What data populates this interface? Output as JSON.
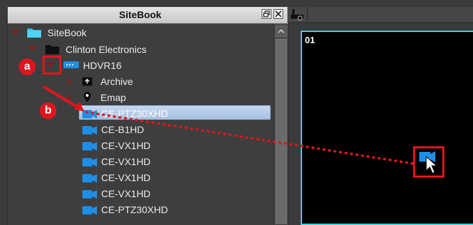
{
  "panel": {
    "title": "SiteBook"
  },
  "tree": {
    "root": "SiteBook",
    "site": "Clinton Electronics",
    "recorder": "HDVR16",
    "archive": "Archive",
    "emap": "Emap",
    "cameras": [
      "CE-PTZ30XHD",
      "CE-B1HD",
      "CE-VX1HD",
      "CE-VX1HD",
      "CE-VX1HD",
      "CE-VX1HD",
      "CE-PTZ30XHD"
    ]
  },
  "viewer": {
    "tile_label": "01"
  },
  "annotations": {
    "a": "a",
    "b": "b"
  },
  "colors": {
    "accent": "#33d6e0",
    "camera_icon": "#1e8fe6",
    "annotation": "#e0151f"
  }
}
